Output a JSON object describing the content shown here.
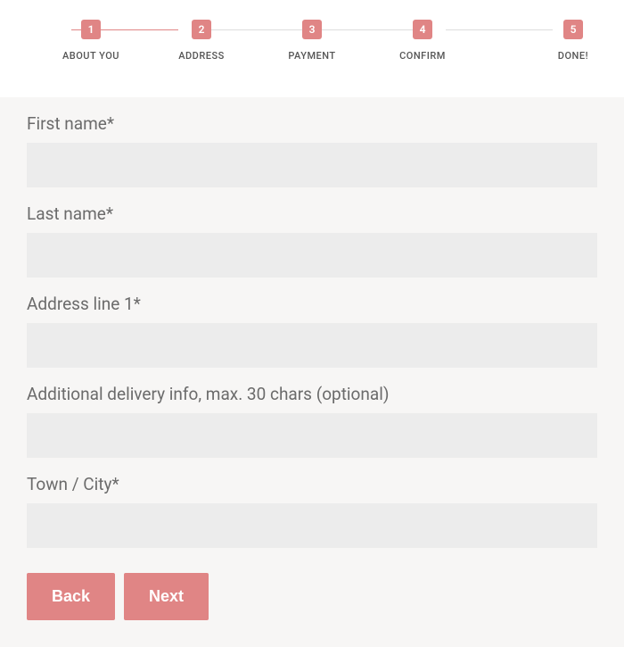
{
  "stepper": {
    "steps": [
      {
        "num": "1",
        "label": "ABOUT YOU"
      },
      {
        "num": "2",
        "label": "ADDRESS"
      },
      {
        "num": "3",
        "label": "PAYMENT"
      },
      {
        "num": "4",
        "label": "CONFIRM"
      },
      {
        "num": "5",
        "label": "DONE!"
      }
    ]
  },
  "form": {
    "first_name": {
      "label": "First name*",
      "value": ""
    },
    "last_name": {
      "label": "Last name*",
      "value": ""
    },
    "address_line_1": {
      "label": "Address line 1*",
      "value": ""
    },
    "additional_info": {
      "label": "Additional delivery info, max. 30 chars (optional)",
      "value": ""
    },
    "town_city": {
      "label": "Town / City*",
      "value": ""
    }
  },
  "buttons": {
    "back": "Back",
    "next": "Next"
  }
}
